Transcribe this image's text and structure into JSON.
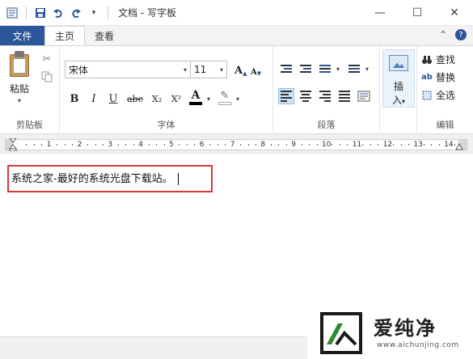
{
  "window": {
    "title": "文档 - 写字板",
    "controls": {
      "minimize": "—",
      "maximize": "☐",
      "close": "✕"
    }
  },
  "quick_access": [
    "app-icon",
    "save-icon",
    "undo-icon",
    "redo-icon",
    "customize-icon"
  ],
  "tabs": {
    "file": "文件",
    "home": "主页",
    "view": "查看"
  },
  "ribbon": {
    "clipboard": {
      "label": "剪贴板",
      "paste": "粘贴"
    },
    "font": {
      "label": "字体",
      "font_name": "宋体",
      "font_size": "11",
      "grow": "A",
      "shrink": "A",
      "bold": "B",
      "italic": "I",
      "underline": "U",
      "strike": "abc",
      "subscript": "X₂",
      "superscript": "X²",
      "color_a": "A"
    },
    "paragraph": {
      "label": "段落"
    },
    "insert": {
      "label1": "插",
      "label2": "入"
    },
    "editing": {
      "label": "编辑",
      "find": "查找",
      "replace": "替换",
      "select_all": "全选"
    }
  },
  "ruler": {
    "numbers": [
      "1",
      "2",
      "3",
      "4",
      "5",
      "6",
      "7",
      "8",
      "9",
      "10",
      "11",
      "12",
      "13",
      "14"
    ]
  },
  "document": {
    "text": "系统之家-最好的系统光盘下载站。"
  },
  "watermark": {
    "brand": "爱纯净",
    "url": "www.aichunjing.com"
  },
  "colors": {
    "accent": "#2b579a",
    "highlight_border": "#d9383a"
  }
}
